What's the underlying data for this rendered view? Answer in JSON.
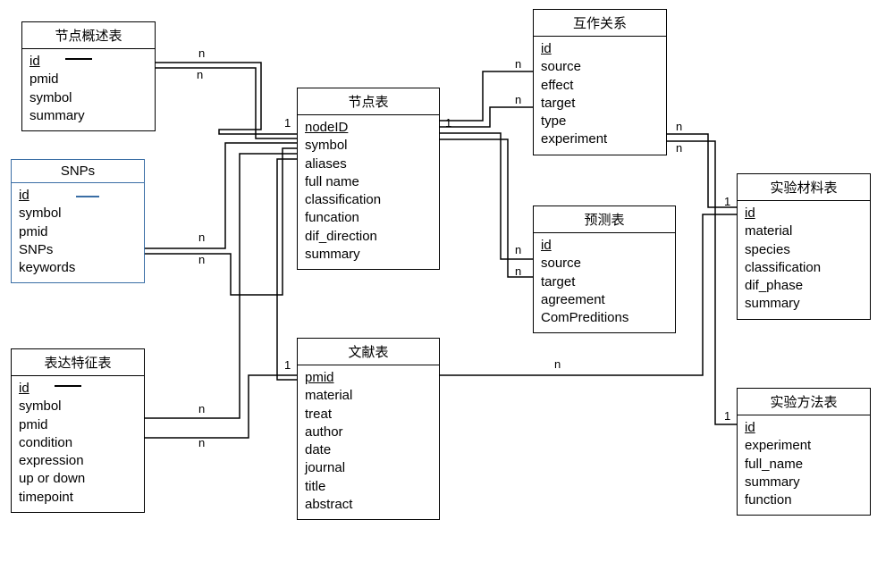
{
  "tables": {
    "nodeSummary": {
      "title": "节点概述表",
      "fields": [
        "id",
        "pmid",
        "symbol",
        "summary"
      ]
    },
    "snps": {
      "title": "SNPs",
      "fields": [
        "id",
        "symbol",
        "pmid",
        "SNPs",
        "keywords"
      ]
    },
    "exprFeature": {
      "title": "表达特征表",
      "fields": [
        "id",
        "symbol",
        "pmid",
        "condition",
        "expression",
        "up or down",
        "timepoint"
      ]
    },
    "node": {
      "title": "节点表",
      "fields": [
        "nodeID",
        "symbol",
        "aliases",
        "full name",
        "classification",
        "funcation",
        "dif_direction",
        "summary"
      ]
    },
    "literature": {
      "title": "文献表",
      "fields": [
        "pmid",
        "material",
        "treat",
        "author",
        "date",
        "journal",
        "title",
        "abstract"
      ]
    },
    "interaction": {
      "title": "互作关系",
      "fields": [
        "id",
        "source",
        "effect",
        "target",
        "type",
        "experiment"
      ]
    },
    "prediction": {
      "title": "预测表",
      "fields": [
        "id",
        "source",
        "target",
        "agreement",
        "ComPreditions"
      ]
    },
    "material": {
      "title": "实验材料表",
      "fields": [
        "id",
        "material",
        "species",
        "classification",
        "dif_phase",
        "summary"
      ]
    },
    "method": {
      "title": "实验方法表",
      "fields": [
        "id",
        "experiment",
        "full_name",
        "summary",
        "function"
      ]
    }
  },
  "cardinality": {
    "one": "1",
    "many": "n"
  }
}
